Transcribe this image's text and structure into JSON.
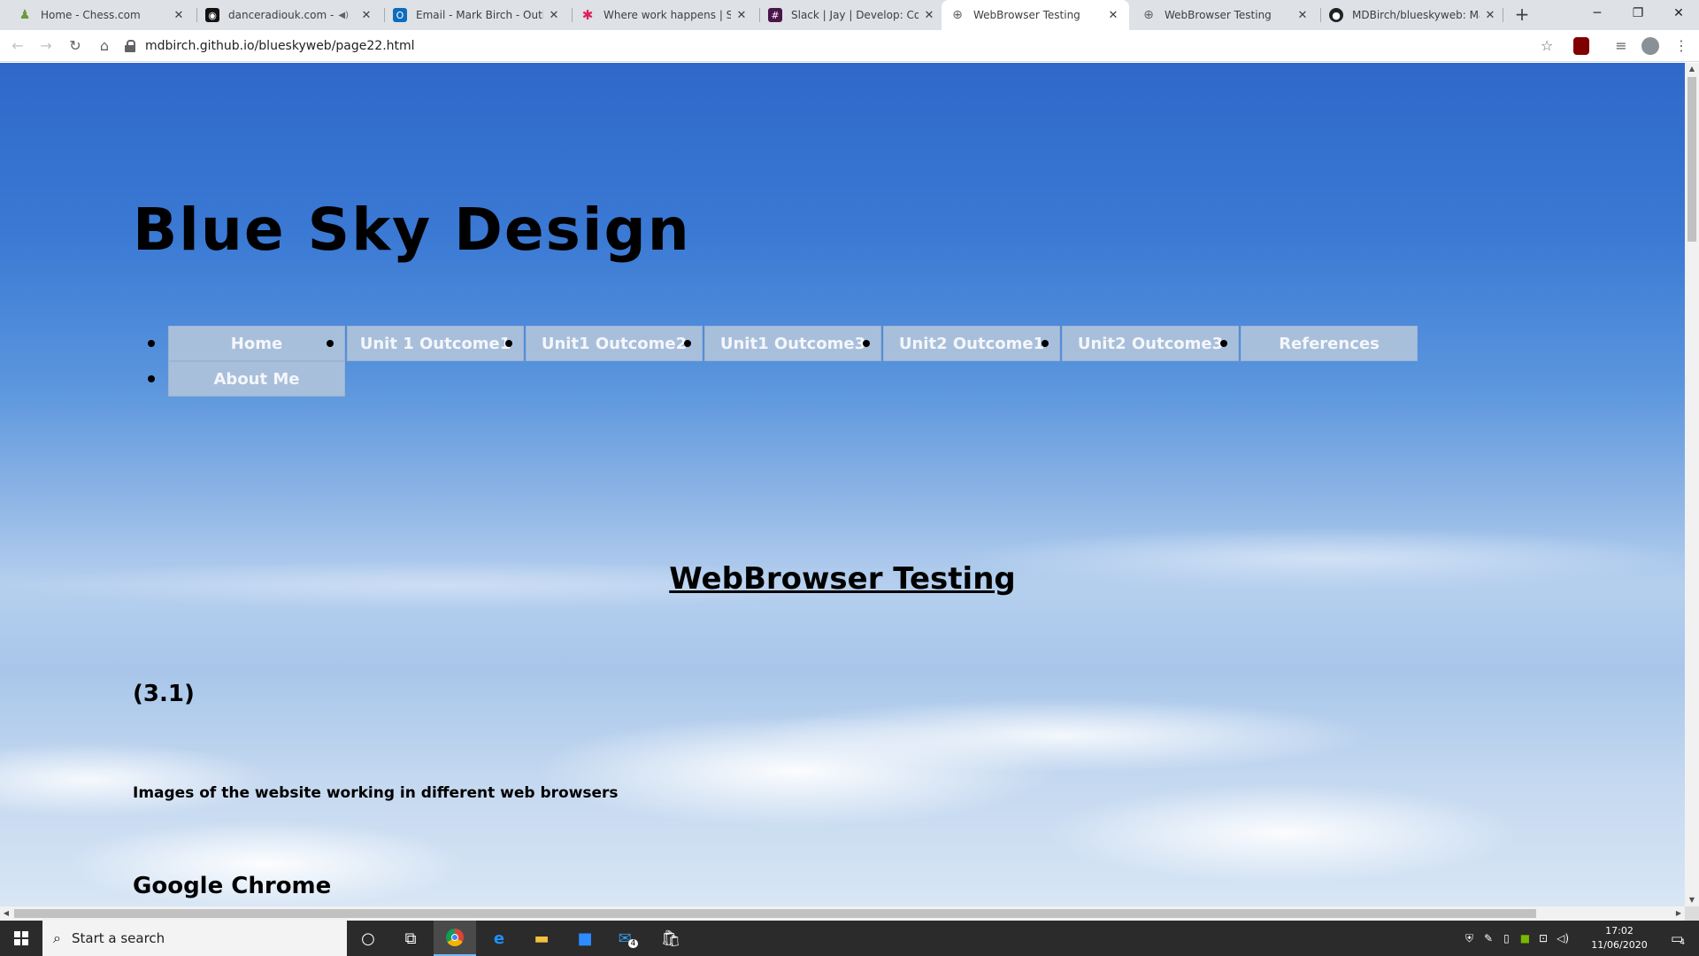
{
  "browser": {
    "tabs": [
      {
        "title": "Home - Chess.com",
        "favicon_color": "#6a9a3a"
      },
      {
        "title": "danceradiouk.com - Da",
        "favicon_color": "#111111"
      },
      {
        "title": "Email - Mark Birch - Outlook",
        "favicon_color": "#0f6cbd"
      },
      {
        "title": "Where work happens | Slack",
        "favicon_color": "#e01e5a"
      },
      {
        "title": "Slack | Jay | Develop: Coding",
        "favicon_color": "#4a154b"
      },
      {
        "title": "WebBrowser Testing",
        "favicon_color": "#5f6368"
      },
      {
        "title": "WebBrowser Testing",
        "favicon_color": "#5f6368"
      },
      {
        "title": "MDBirch/blueskyweb: Mark",
        "favicon_color": "#202124"
      }
    ],
    "active_tab_index": 5,
    "new_tab_label": "+",
    "url": "mdbirch.github.io/blueskyweb/page22.html"
  },
  "site": {
    "title": "Blue Sky Design",
    "nav": [
      {
        "label": "Home"
      },
      {
        "label": "Unit 1 Outcome1"
      },
      {
        "label": "Unit1 Outcome2"
      },
      {
        "label": "Unit1 Outcome3"
      },
      {
        "label": "Unit2 Outcome1"
      },
      {
        "label": "Unit2 Outcome3"
      },
      {
        "label": "References"
      },
      {
        "label": "About Me"
      }
    ],
    "page_heading": "WebBrowser Testing",
    "section_number": "(3.1)",
    "description": "Images of the website working in different web browsers",
    "sub_heading": "Google Chrome"
  },
  "taskbar": {
    "search_placeholder": "Start a search",
    "mail_badge": "4",
    "time": "17:02",
    "date": "11/06/2020",
    "notification_count": "4"
  }
}
